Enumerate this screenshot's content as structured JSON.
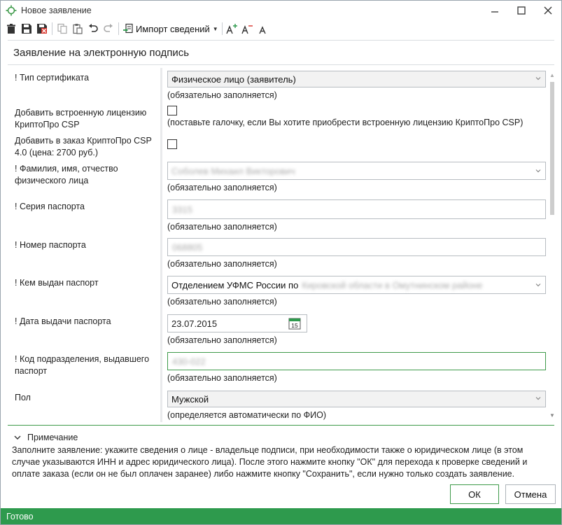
{
  "window": {
    "title": "Новое заявление",
    "minimize": "—",
    "maximize": "☐",
    "close": "✕"
  },
  "toolbar": {
    "import_label": "Импорт сведений"
  },
  "form": {
    "title": "Заявление на электронную подпись",
    "fields": {
      "cert_type": {
        "label": "! Тип сертификата",
        "value": "Физическое лицо (заявитель)",
        "hint": "(обязательно заполняется)"
      },
      "builtin_license": {
        "label": "Добавить встроенную лицензию КриптоПро CSP",
        "hint": "(поставьте галочку, если Вы хотите приобрести встроенную лицензию КриптоПро CSP)"
      },
      "add_csp": {
        "label": "Добавить в заказ КриптоПро CSP 4.0 (цена: 2700 руб.)"
      },
      "full_name": {
        "label": "! Фамилия, имя, отчество физического лица",
        "value": "Соболев Михаил Викторович",
        "hint": "(обязательно заполняется)"
      },
      "passport_series": {
        "label": "! Серия паспорта",
        "value": "3315",
        "hint": "(обязательно заполняется)"
      },
      "passport_number": {
        "label": "! Номер паспорта",
        "value": "068805",
        "hint": "(обязательно заполняется)"
      },
      "issued_by": {
        "label": "! Кем выдан паспорт",
        "value_prefix": "Отделением УФМС России по",
        "value_rest": "Кировской области в Омутнинском районе",
        "hint": "(обязательно заполняется)"
      },
      "issue_date": {
        "label": "! Дата выдачи паспорта",
        "value": "23.07.2015",
        "calendar_day": "15",
        "hint": "(обязательно заполняется)"
      },
      "division_code": {
        "label": "! Код подразделения, выдавшего паспорт",
        "value": "430-022",
        "hint": "(обязательно заполняется)"
      },
      "gender": {
        "label": "Пол",
        "value": "Мужской",
        "hint": "(определяется автоматически по ФИО)"
      }
    }
  },
  "note": {
    "title": "Примечание",
    "text": "Заполните заявление: укажите сведения о лице - владельце подписи, при необходимости также о юридическом лице (в этом случае указываются ИНН и адрес юридического лица). После этого нажмите кнопку \"ОК\" для перехода к проверке сведений и оплате заказа (если он не был оплачен заранее) либо нажмите кнопку \"Сохранить\", если нужно только создать заявление."
  },
  "buttons": {
    "ok": "ОК",
    "cancel": "Отмена"
  },
  "status": {
    "text": "Готово"
  },
  "colors": {
    "accent": "#2e9a4d",
    "focus_border": "#3e9a4a"
  }
}
